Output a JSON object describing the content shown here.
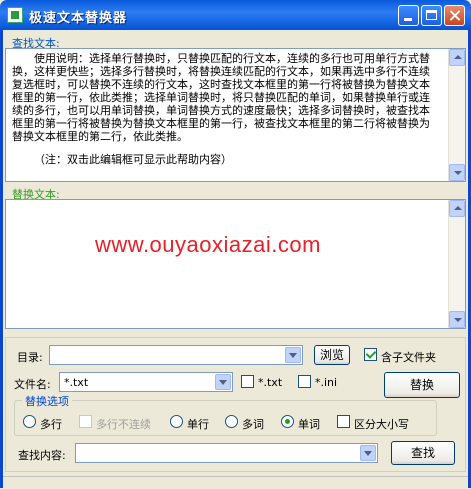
{
  "window": {
    "title": "极速文本替换器"
  },
  "search": {
    "label": "查找文本:",
    "description": "使用说明：选择单行替换时，只替换匹配的行文本，连续的多行也可用单行方式替换，这样更快些；选择多行替换时，将替换连续匹配的行文本，如果再选中多行不连续复选框时，可以替换不连续的行文本，这时查找文本框里的第一行将被替换为替换文本框里的第一行，依此类推；选择单词替换时，将只替换匹配的单词，如果替换单行或连续的多行，也可以用单词替换，单词替换方式的速度最快；选择多词替换时，被查找本框里的第一行将被替换为替换文本框里的第一行，被查找文本框里的第二行将被替换为替换文本框里的第二行，依此类推。",
    "note": "（注：双击此编辑框可显示此帮助内容）"
  },
  "replace": {
    "label": "替换文本:",
    "value": ""
  },
  "watermark": "www.ouyaoxiazai.com",
  "options": {
    "dir_label": "目录:",
    "dir_value": "",
    "browse_label": "浏览",
    "subfolder_label": "含子文件夹",
    "subfolder_checked": true,
    "filename_label": "文件名:",
    "filename_value": "*.txt",
    "ext_txt_label": "*.txt",
    "ext_ini_label": "*.ini",
    "replace_button_label": "替换",
    "group_title": "替换选项",
    "multiline_label": "多行",
    "multiline_noncontig_label": "多行不连续",
    "singleline_label": "单行",
    "multiword_label": "多词",
    "word_label": "单词",
    "case_label": "区分大小写",
    "selected_mode": "单词",
    "find_content_label": "查找内容:",
    "find_content_value": "",
    "find_button_label": "查找"
  }
}
